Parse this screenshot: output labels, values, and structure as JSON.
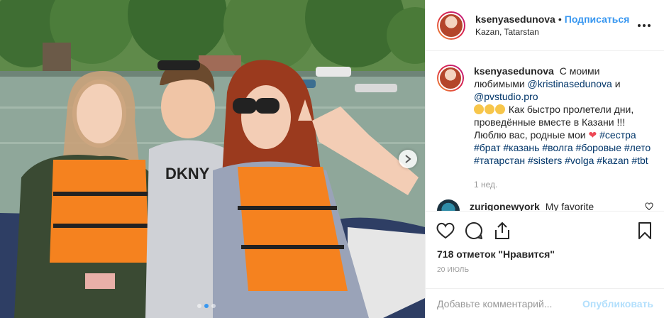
{
  "post": {
    "username": "ksenyasedunova",
    "separator": "•",
    "follow_label": "Подписаться",
    "location": "Kazan, Tatarstan",
    "more_icon": "ellipsis-icon"
  },
  "caption": {
    "username": "ksenyasedunova",
    "text_1": "С моими любимыми",
    "mention_1": "@kristinasedunova",
    "and": "и",
    "mention_2": "@pvstudio.pro",
    "text_2": "Как быстро пролетели дни, проведённые вместе в Казани !!! Люблю вас, родные мои",
    "hashtags": [
      "#сестра",
      "#брат",
      "#казань",
      "#волга",
      "#боровые",
      "#лето",
      "#татарстан",
      "#sisters",
      "#volga",
      "#kazan",
      "#tbt"
    ],
    "time_ago": "1 нед."
  },
  "comment": {
    "username": "zurigonewyork",
    "text": "My favorite"
  },
  "actions": {
    "likes": "718 отметок \"Нравится\"",
    "date": "20 ИЮЛЬ"
  },
  "add_comment": {
    "placeholder": "Добавьте комментарий...",
    "publish_label": "Опубликовать"
  },
  "carousel": {
    "slides": 3,
    "active": 2
  },
  "colors": {
    "link": "#003569",
    "follow": "#3897f0",
    "heart": "#ed4956",
    "vest": "#f5821f"
  }
}
